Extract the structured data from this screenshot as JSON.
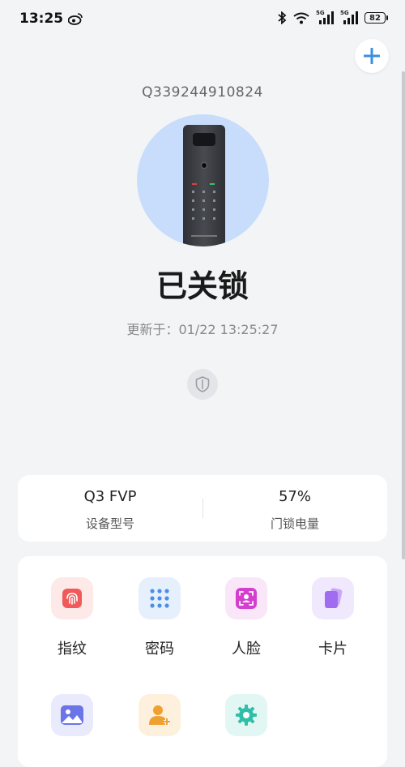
{
  "status_bar": {
    "time": "13:25",
    "battery": "82",
    "network_1": "5G",
    "network_2": "5G"
  },
  "device": {
    "id": "Q339244910824",
    "lock_status": "已关锁",
    "updated_label": "更新于：01/22 13:25:27"
  },
  "info": {
    "model_value": "Q3 FVP",
    "model_label": "设备型号",
    "battery_value": "57%",
    "battery_label": "门锁电量"
  },
  "functions": [
    {
      "label": "指纹",
      "icon": "fingerprint-icon",
      "color": "#f05a5a",
      "bg": "#fde9e8"
    },
    {
      "label": "密码",
      "icon": "keypad-icon",
      "color": "#4a90e8",
      "bg": "#e6f0fc"
    },
    {
      "label": "人脸",
      "icon": "face-scan-icon",
      "color": "#d43fd0",
      "bg": "#f9e6f8"
    },
    {
      "label": "卡片",
      "icon": "card-icon",
      "color": "#a06cf0",
      "bg": "#f0e8fd"
    },
    {
      "label": "",
      "icon": "image-icon",
      "color": "#6b74e8",
      "bg": "#e9eafc"
    },
    {
      "label": "",
      "icon": "add-user-icon",
      "color": "#f0a030",
      "bg": "#fdf0dd"
    },
    {
      "label": "",
      "icon": "settings-icon",
      "color": "#2fbfa8",
      "bg": "#e2f7f3"
    }
  ],
  "colors": {
    "accent": "#3a8ee6",
    "background": "#f3f4f6",
    "device_circle": "#c8ddfb"
  }
}
